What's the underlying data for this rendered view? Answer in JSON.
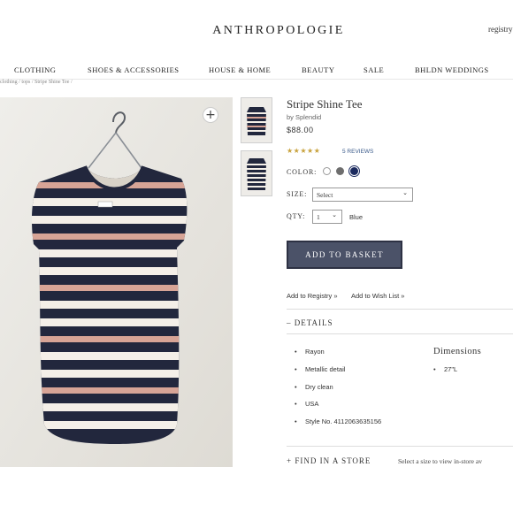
{
  "header": {
    "brand": "ANTHROPOLOGIE",
    "registry_link": "registry"
  },
  "nav": {
    "items": [
      {
        "label": "CLOTHING"
      },
      {
        "label": "SHOES & ACCESSORIES"
      },
      {
        "label": "HOUSE & HOME"
      },
      {
        "label": "BEAUTY"
      },
      {
        "label": "SALE"
      },
      {
        "label": "BHLDN WEDDINGS"
      }
    ]
  },
  "breadcrumb": "clothing / tops / Stripe Shine Tee /",
  "product": {
    "title": "Stripe Shine Tee",
    "byline": "by Splendid",
    "price": "$88.00",
    "rating": 5,
    "stars": "★★★★★",
    "reviews_label": "5 REVIEWS",
    "zoom_symbol": "+",
    "color_label": "COLOR:",
    "swatches": [
      {
        "name": "white",
        "hex": "#ffffff"
      },
      {
        "name": "grey",
        "hex": "#6e6e6e"
      },
      {
        "name": "navy",
        "hex": "#1b2a5e"
      }
    ],
    "size_label": "SIZE:",
    "size_value": "Select",
    "qty_label": "QTY:",
    "qty_value": "1",
    "selected_color": "Blue",
    "add_to_basket": "ADD TO BASKET",
    "add_to_registry": "Add to Registry »",
    "add_to_wishlist": "Add to Wish List »",
    "details_toggle": "–   DETAILS",
    "details": [
      "Rayon",
      "Metallic detail",
      "Dry clean",
      "USA",
      "Style No. 4112063635156"
    ],
    "dimensions_title": "Dimensions",
    "dimensions": [
      "27\"L"
    ],
    "find_in_store": "+    FIND IN A STORE",
    "store_hint": "Select a size to view in-store av"
  },
  "colors": {
    "button_bg": "#4b5268",
    "star": "#c8a23c",
    "stripe_navy": "#22273d",
    "stripe_pink": "#d7a496",
    "stripe_white": "#f4efe8"
  }
}
